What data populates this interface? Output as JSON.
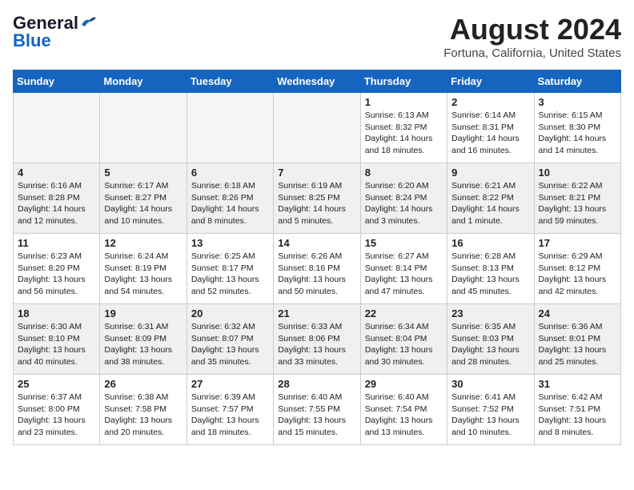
{
  "header": {
    "logo_line1": "General",
    "logo_line2": "Blue",
    "month_year": "August 2024",
    "location": "Fortuna, California, United States"
  },
  "days_of_week": [
    "Sunday",
    "Monday",
    "Tuesday",
    "Wednesday",
    "Thursday",
    "Friday",
    "Saturday"
  ],
  "weeks": [
    [
      {
        "day": "",
        "text": "",
        "empty": true
      },
      {
        "day": "",
        "text": "",
        "empty": true
      },
      {
        "day": "",
        "text": "",
        "empty": true
      },
      {
        "day": "",
        "text": "",
        "empty": true
      },
      {
        "day": "1",
        "text": "Sunrise: 6:13 AM\nSunset: 8:32 PM\nDaylight: 14 hours\nand 18 minutes."
      },
      {
        "day": "2",
        "text": "Sunrise: 6:14 AM\nSunset: 8:31 PM\nDaylight: 14 hours\nand 16 minutes."
      },
      {
        "day": "3",
        "text": "Sunrise: 6:15 AM\nSunset: 8:30 PM\nDaylight: 14 hours\nand 14 minutes."
      }
    ],
    [
      {
        "day": "4",
        "text": "Sunrise: 6:16 AM\nSunset: 8:28 PM\nDaylight: 14 hours\nand 12 minutes.",
        "gray": true
      },
      {
        "day": "5",
        "text": "Sunrise: 6:17 AM\nSunset: 8:27 PM\nDaylight: 14 hours\nand 10 minutes.",
        "gray": true
      },
      {
        "day": "6",
        "text": "Sunrise: 6:18 AM\nSunset: 8:26 PM\nDaylight: 14 hours\nand 8 minutes.",
        "gray": true
      },
      {
        "day": "7",
        "text": "Sunrise: 6:19 AM\nSunset: 8:25 PM\nDaylight: 14 hours\nand 5 minutes.",
        "gray": true
      },
      {
        "day": "8",
        "text": "Sunrise: 6:20 AM\nSunset: 8:24 PM\nDaylight: 14 hours\nand 3 minutes.",
        "gray": true
      },
      {
        "day": "9",
        "text": "Sunrise: 6:21 AM\nSunset: 8:22 PM\nDaylight: 14 hours\nand 1 minute.",
        "gray": true
      },
      {
        "day": "10",
        "text": "Sunrise: 6:22 AM\nSunset: 8:21 PM\nDaylight: 13 hours\nand 59 minutes.",
        "gray": true
      }
    ],
    [
      {
        "day": "11",
        "text": "Sunrise: 6:23 AM\nSunset: 8:20 PM\nDaylight: 13 hours\nand 56 minutes."
      },
      {
        "day": "12",
        "text": "Sunrise: 6:24 AM\nSunset: 8:19 PM\nDaylight: 13 hours\nand 54 minutes."
      },
      {
        "day": "13",
        "text": "Sunrise: 6:25 AM\nSunset: 8:17 PM\nDaylight: 13 hours\nand 52 minutes."
      },
      {
        "day": "14",
        "text": "Sunrise: 6:26 AM\nSunset: 8:16 PM\nDaylight: 13 hours\nand 50 minutes."
      },
      {
        "day": "15",
        "text": "Sunrise: 6:27 AM\nSunset: 8:14 PM\nDaylight: 13 hours\nand 47 minutes."
      },
      {
        "day": "16",
        "text": "Sunrise: 6:28 AM\nSunset: 8:13 PM\nDaylight: 13 hours\nand 45 minutes."
      },
      {
        "day": "17",
        "text": "Sunrise: 6:29 AM\nSunset: 8:12 PM\nDaylight: 13 hours\nand 42 minutes."
      }
    ],
    [
      {
        "day": "18",
        "text": "Sunrise: 6:30 AM\nSunset: 8:10 PM\nDaylight: 13 hours\nand 40 minutes.",
        "gray": true
      },
      {
        "day": "19",
        "text": "Sunrise: 6:31 AM\nSunset: 8:09 PM\nDaylight: 13 hours\nand 38 minutes.",
        "gray": true
      },
      {
        "day": "20",
        "text": "Sunrise: 6:32 AM\nSunset: 8:07 PM\nDaylight: 13 hours\nand 35 minutes.",
        "gray": true
      },
      {
        "day": "21",
        "text": "Sunrise: 6:33 AM\nSunset: 8:06 PM\nDaylight: 13 hours\nand 33 minutes.",
        "gray": true
      },
      {
        "day": "22",
        "text": "Sunrise: 6:34 AM\nSunset: 8:04 PM\nDaylight: 13 hours\nand 30 minutes.",
        "gray": true
      },
      {
        "day": "23",
        "text": "Sunrise: 6:35 AM\nSunset: 8:03 PM\nDaylight: 13 hours\nand 28 minutes.",
        "gray": true
      },
      {
        "day": "24",
        "text": "Sunrise: 6:36 AM\nSunset: 8:01 PM\nDaylight: 13 hours\nand 25 minutes.",
        "gray": true
      }
    ],
    [
      {
        "day": "25",
        "text": "Sunrise: 6:37 AM\nSunset: 8:00 PM\nDaylight: 13 hours\nand 23 minutes."
      },
      {
        "day": "26",
        "text": "Sunrise: 6:38 AM\nSunset: 7:58 PM\nDaylight: 13 hours\nand 20 minutes."
      },
      {
        "day": "27",
        "text": "Sunrise: 6:39 AM\nSunset: 7:57 PM\nDaylight: 13 hours\nand 18 minutes."
      },
      {
        "day": "28",
        "text": "Sunrise: 6:40 AM\nSunset: 7:55 PM\nDaylight: 13 hours\nand 15 minutes."
      },
      {
        "day": "29",
        "text": "Sunrise: 6:40 AM\nSunset: 7:54 PM\nDaylight: 13 hours\nand 13 minutes."
      },
      {
        "day": "30",
        "text": "Sunrise: 6:41 AM\nSunset: 7:52 PM\nDaylight: 13 hours\nand 10 minutes."
      },
      {
        "day": "31",
        "text": "Sunrise: 6:42 AM\nSunset: 7:51 PM\nDaylight: 13 hours\nand 8 minutes."
      }
    ]
  ]
}
